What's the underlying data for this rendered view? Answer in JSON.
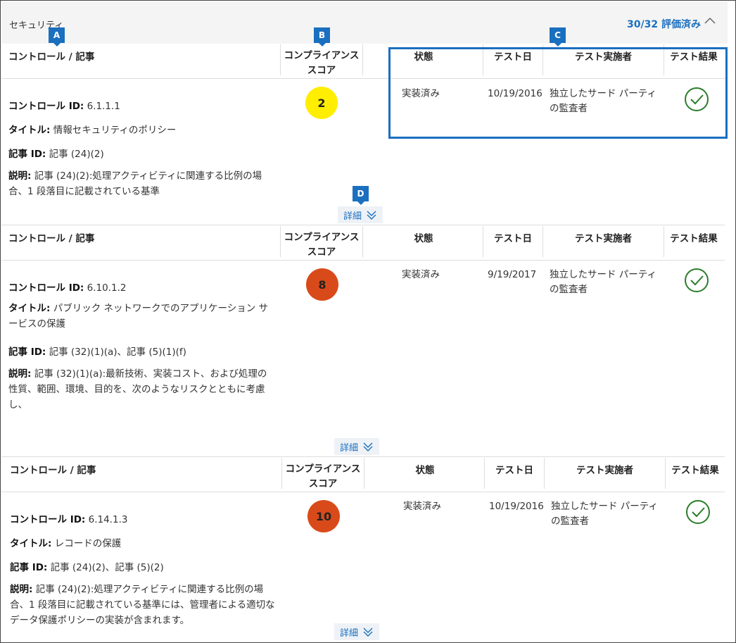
{
  "header": {
    "section": "セキュリティ",
    "evaluated": "30/32 評価済み"
  },
  "columns": {
    "control": "コントロール / 記事",
    "score_l1": "コンプライアンス",
    "score_l2": "スコア",
    "status": "状態",
    "test_date": "テスト日",
    "tester": "テスト実施者",
    "result": "テスト結果"
  },
  "labels": {
    "control_id": "コントロール ID:",
    "title": "タイトル:",
    "article_id": "記事 ID:",
    "description": "説明:",
    "details": "詳細"
  },
  "callouts": [
    "A",
    "B",
    "C",
    "D"
  ],
  "colors": {
    "accent": "#1a6fbf",
    "score_low": "#ffee00",
    "score_high": "#d94a1a",
    "pass": "#2a7d2a"
  },
  "rows": [
    {
      "control_id": "6.1.1.1",
      "title": "情報セキュリティのポリシー",
      "article_id": "記事 (24)(2)",
      "description": "記事 (24)(2):処理アクティビティに関連する比例の場合、1 段落目に記載されている基準",
      "score": "2",
      "status": "実装済み",
      "test_date": "10/19/2016",
      "tester": "独立したサード パーティの監査者",
      "result_icon": "check-circle-icon"
    },
    {
      "control_id": "6.10.1.2",
      "title": "パブリック ネットワークでのアプリケーション サービスの保護",
      "article_id": "記事 (32)(1)(a)、記事 (5)(1)(f)",
      "description": "記事 (32)(1)(a):最新技術、実装コスト、および処理の性質、範囲、環境、目的を、次のようなリスクとともに考慮し、",
      "score": "8",
      "status": "実装済み",
      "test_date": "9/19/2017",
      "tester": "独立したサード パーティの監査者",
      "result_icon": "check-circle-icon"
    },
    {
      "control_id": "6.14.1.3",
      "title": "レコードの保護",
      "article_id": "記事 (24)(2)、記事 (5)(2)",
      "description": "記事 (24)(2):処理アクティビティに関連する比例の場合、1 段落目に記載されている基準には、管理者による適切なデータ保護ポリシーの実装が含まれます。",
      "score": "10",
      "status": "実装済み",
      "test_date": "10/19/2016",
      "tester": "独立したサード パーティの監査者",
      "result_icon": "check-circle-icon"
    }
  ]
}
